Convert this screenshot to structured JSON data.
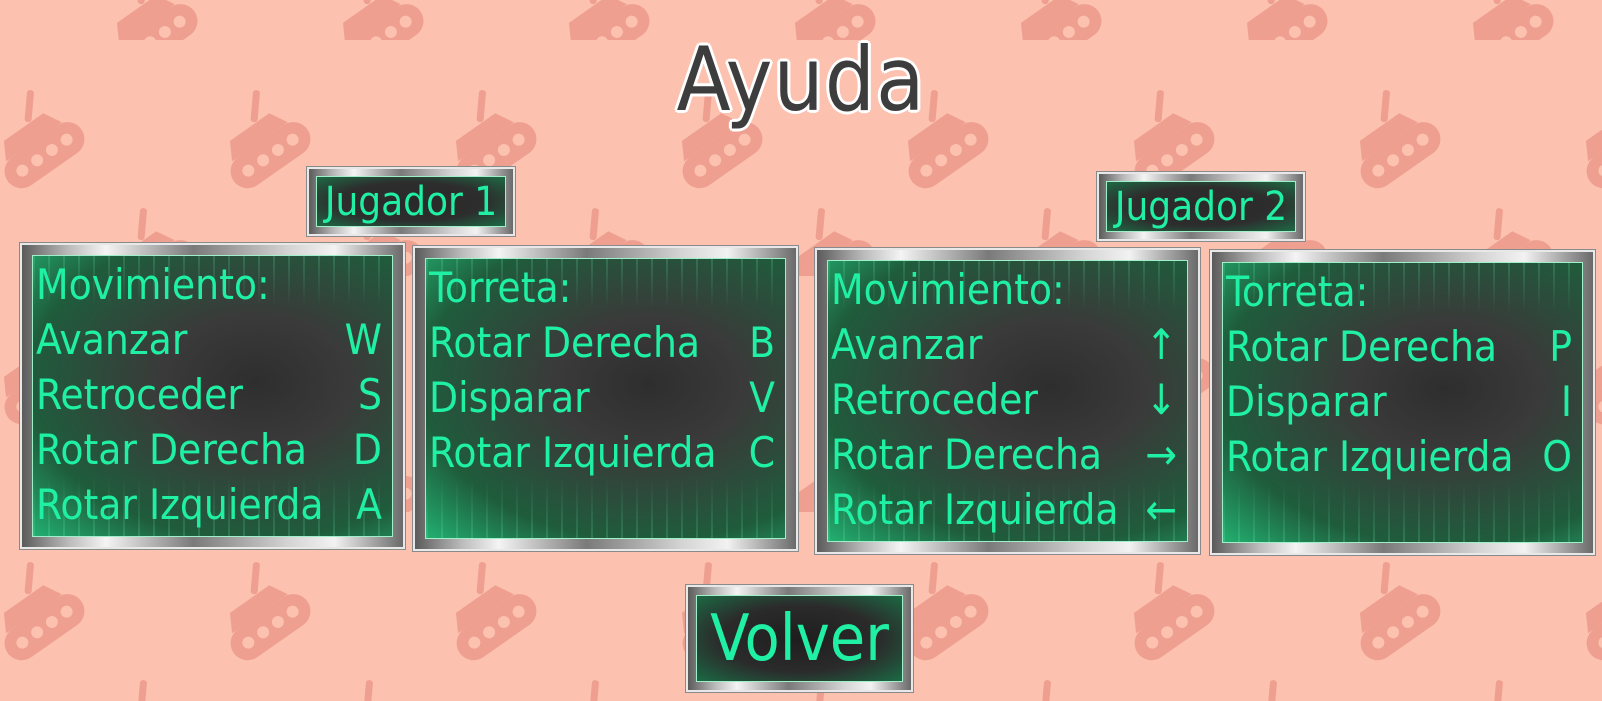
{
  "screen": {
    "title": "Ayuda",
    "background_color": "#fcc1af",
    "accent_color": "#1ff0a4",
    "background_pattern_icon": "tank-icon"
  },
  "player1": {
    "label": "Jugador 1",
    "movement": {
      "heading": "Movimiento:",
      "rows": [
        {
          "action": "Avanzar",
          "key": "W"
        },
        {
          "action": "Retroceder",
          "key": "S"
        },
        {
          "action": "Rotar Derecha",
          "key": "D"
        },
        {
          "action": "Rotar Izquierda",
          "key": "A"
        }
      ]
    },
    "turret": {
      "heading": "Torreta:",
      "rows": [
        {
          "action": "Rotar Derecha",
          "key": "B"
        },
        {
          "action": "Disparar",
          "key": "V"
        },
        {
          "action": "Rotar Izquierda",
          "key": "C"
        }
      ]
    }
  },
  "player2": {
    "label": "Jugador 2",
    "movement": {
      "heading": "Movimiento:",
      "rows": [
        {
          "action": "Avanzar",
          "key": "↑"
        },
        {
          "action": "Retroceder",
          "key": "↓"
        },
        {
          "action": "Rotar Derecha",
          "key": "→"
        },
        {
          "action": "Rotar Izquierda",
          "key": "←"
        }
      ]
    },
    "turret": {
      "heading": "Torreta:",
      "rows": [
        {
          "action": "Rotar Derecha",
          "key": "P"
        },
        {
          "action": "Disparar",
          "key": "I"
        },
        {
          "action": "Rotar Izquierda",
          "key": "O"
        }
      ]
    }
  },
  "back_button": {
    "label": "Volver"
  }
}
